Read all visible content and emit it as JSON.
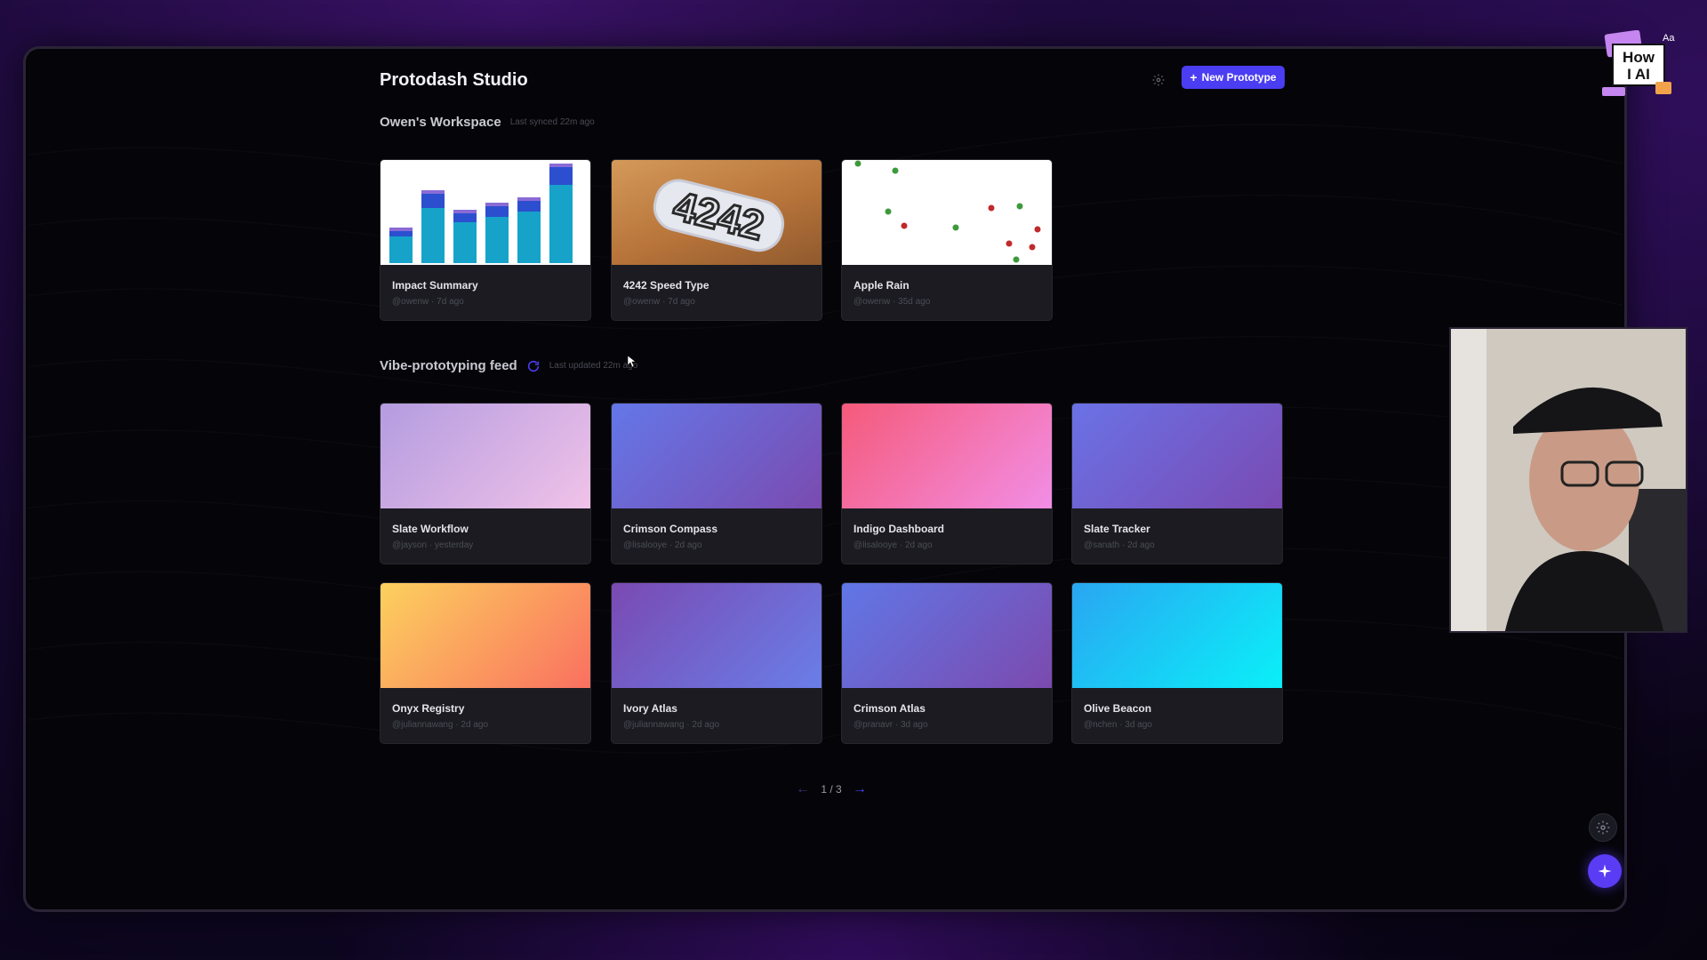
{
  "app": {
    "title": "Protodash Studio",
    "new_button_label": "New Prototype"
  },
  "workspace": {
    "title": "Owen's Workspace",
    "sync_status": "Last synced 22m ago",
    "cards": [
      {
        "title": "Impact Summary",
        "meta": "@owenw · 7d ago",
        "thumb": "bar-chart"
      },
      {
        "title": "4242 Speed Type",
        "meta": "@owenw · 7d ago",
        "thumb": "sticker"
      },
      {
        "title": "Apple Rain",
        "meta": "@owenw · 35d ago",
        "thumb": "apples"
      }
    ]
  },
  "feed": {
    "title": "Vibe-prototyping feed",
    "update_status": "Last updated 22m ago",
    "cards": [
      {
        "title": "Slate Workflow",
        "meta": "@jayson · yesterday",
        "gradient": [
          "#b49ce0",
          "#f0c2e8"
        ]
      },
      {
        "title": "Crimson Compass",
        "meta": "@lisalooye · 2d ago",
        "gradient": [
          "#6477e8",
          "#7a4bb0"
        ]
      },
      {
        "title": "Indigo Dashboard",
        "meta": "@lisalooye · 2d ago",
        "gradient": [
          "#f55a7a",
          "#f28ee6"
        ]
      },
      {
        "title": "Slate Tracker",
        "meta": "@sanath · 2d ago",
        "gradient": [
          "#6a72e6",
          "#7a4ab2"
        ]
      },
      {
        "title": "Onyx Registry",
        "meta": "@juliannawang · 2d ago",
        "gradient": [
          "#fcd15e",
          "#fa7060"
        ]
      },
      {
        "title": "Ivory Atlas",
        "meta": "@juliannawang · 2d ago",
        "gradient": [
          "#7a4ab2",
          "#6a7ee8"
        ]
      },
      {
        "title": "Crimson Atlas",
        "meta": "@pranavr · 3d ago",
        "gradient": [
          "#6077e6",
          "#7c4aae"
        ]
      },
      {
        "title": "Olive Beacon",
        "meta": "@nchen · 3d ago",
        "gradient": [
          "#2aa6f2",
          "#0af0f8"
        ]
      }
    ]
  },
  "pagination": {
    "label": "1 / 3",
    "prev_icon": "arrow-left-icon",
    "next_icon": "arrow-right-icon"
  },
  "logo": {
    "text_line1": "How",
    "text_line2": "I AI",
    "corner": "Aa"
  },
  "colors": {
    "accent": "#4b3df2",
    "card_bg": "#1b1b21",
    "window_bg": "#050509"
  }
}
